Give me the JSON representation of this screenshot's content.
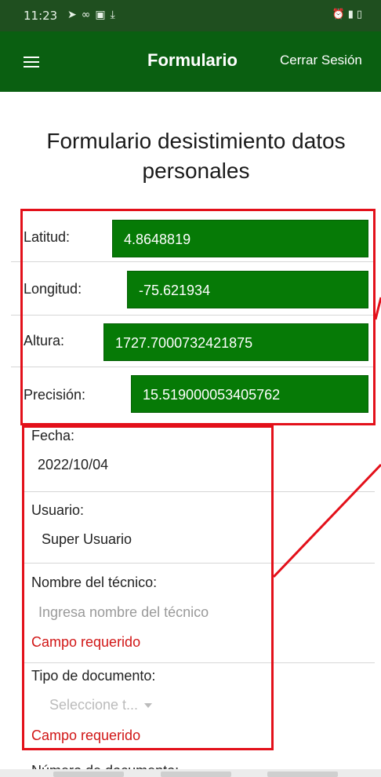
{
  "status_bar": {
    "time": "11:23",
    "left_icons": [
      "send-icon",
      "voicemail-icon",
      "image-icon",
      "download-icon"
    ],
    "right_icons": [
      "alarm-icon",
      "signal-icon",
      "battery-icon"
    ]
  },
  "app_bar": {
    "menu_icon": "hamburger-icon",
    "title": "Formulario",
    "logout_label": "Cerrar Sesión",
    "background_color": "#0a5f11"
  },
  "form": {
    "title": "Formulario desistimiento datos personales",
    "coordinates": {
      "accent_color": "#067a06",
      "latitude": {
        "label": "Latitud:",
        "value": "4.8648819"
      },
      "longitude": {
        "label": "Longitud:",
        "value": "-75.621934"
      },
      "altitude": {
        "label": "Altura:",
        "value": "1727.7000732421875"
      },
      "precision": {
        "label": "Precisión:",
        "value": "15.519000053405762"
      }
    },
    "date": {
      "label": "Fecha:",
      "value": "2022/10/04"
    },
    "user": {
      "label": "Usuario:",
      "value": "Super Usuario"
    },
    "technician": {
      "label": "Nombre del técnico:",
      "placeholder": "Ingresa nombre del técnico",
      "error": "Campo requerido"
    },
    "document_type": {
      "label": "Tipo de documento:",
      "placeholder": "Seleccione t...",
      "error": "Campo requerido"
    },
    "document_number": {
      "label": "Número de documento:"
    }
  },
  "annotation": {
    "highlight_color": "#e3101a"
  }
}
